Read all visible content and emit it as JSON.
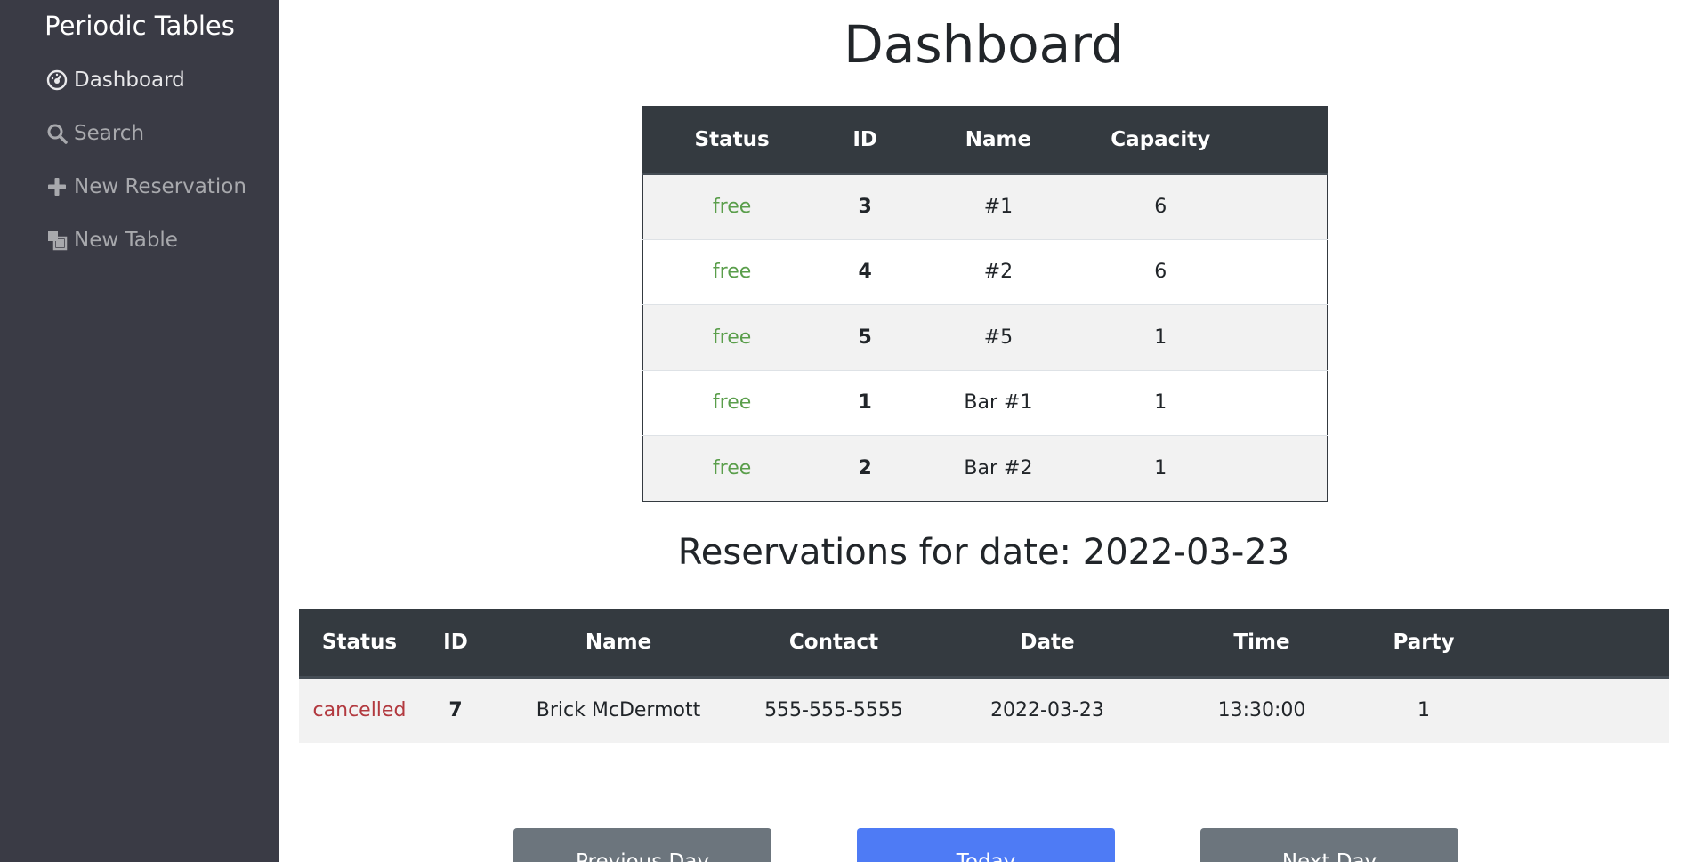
{
  "sidebar": {
    "brand": "Periodic Tables",
    "items": [
      {
        "label": "Dashboard",
        "icon": "dashboard-icon"
      },
      {
        "label": "Search",
        "icon": "search-icon"
      },
      {
        "label": "New Reservation",
        "icon": "plus-icon"
      },
      {
        "label": "New Table",
        "icon": "new-table-icon"
      }
    ]
  },
  "main": {
    "title": "Dashboard",
    "tables": {
      "headers": [
        "Status",
        "ID",
        "Name",
        "Capacity"
      ],
      "rows": [
        {
          "status": "free",
          "id": "3",
          "name": "#1",
          "capacity": "6"
        },
        {
          "status": "free",
          "id": "4",
          "name": "#2",
          "capacity": "6"
        },
        {
          "status": "free",
          "id": "5",
          "name": "#5",
          "capacity": "1"
        },
        {
          "status": "free",
          "id": "1",
          "name": "Bar #1",
          "capacity": "1"
        },
        {
          "status": "free",
          "id": "2",
          "name": "Bar #2",
          "capacity": "1"
        }
      ]
    },
    "reservations_heading": "Reservations for date: 2022-03-23",
    "reservations": {
      "headers": [
        "Status",
        "ID",
        "Name",
        "Contact",
        "Date",
        "Time",
        "Party"
      ],
      "rows": [
        {
          "status": "cancelled",
          "id": "7",
          "name": "Brick McDermott",
          "contact": "555-555-5555",
          "date": "2022-03-23",
          "time": "13:30:00",
          "party": "1"
        }
      ]
    },
    "buttons": {
      "previous": "Previous Day",
      "today": "Today",
      "next": "Next Day"
    }
  },
  "colors": {
    "sidebar_bg": "#3a3b45",
    "table_header_bg": "#343a40",
    "free_status": "#5a9e4b",
    "cancelled_status": "#b2393f",
    "primary_button": "#4e7bf5",
    "secondary_button": "#6c757d"
  }
}
